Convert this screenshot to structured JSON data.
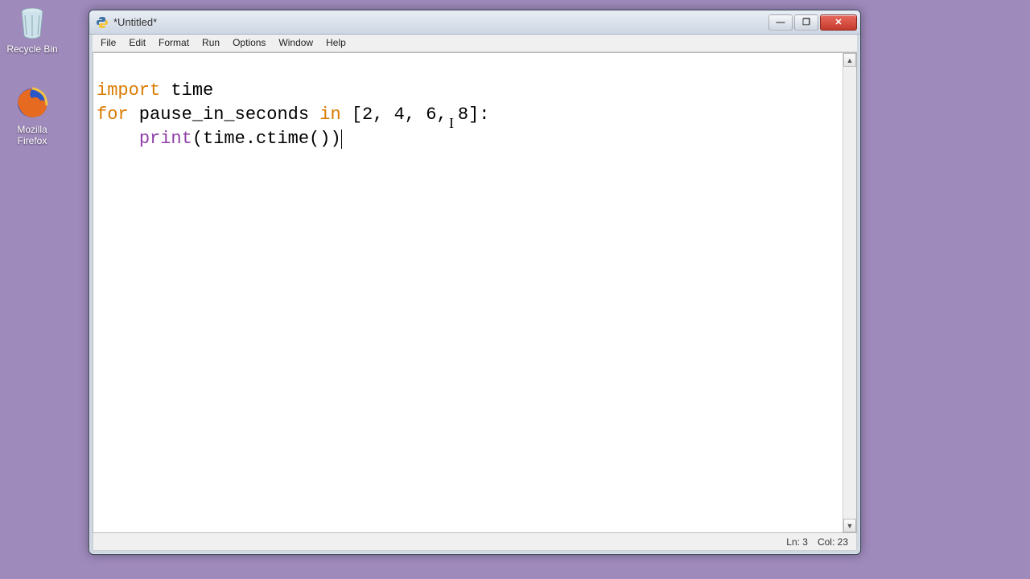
{
  "desktop": {
    "icons": [
      {
        "name": "recycle-bin",
        "label": "Recycle Bin"
      },
      {
        "name": "firefox",
        "label": "Mozilla\nFirefox"
      }
    ]
  },
  "window": {
    "title": "*Untitled*",
    "menubar": [
      "File",
      "Edit",
      "Format",
      "Run",
      "Options",
      "Window",
      "Help"
    ],
    "code": {
      "line1": {
        "kw": "import",
        "rest": " time"
      },
      "line2": {
        "kw1": "for",
        "mid": " pause_in_seconds ",
        "kw2": "in",
        "rest": " [2, 4, 6, 8]:"
      },
      "line3": {
        "indent": "    ",
        "fn": "print",
        "rest": "(time.ctime())"
      }
    },
    "status": {
      "line": "Ln: 3",
      "col": "Col: 23"
    },
    "buttons": {
      "min": "—",
      "max": "❐",
      "close": "✕"
    },
    "scroll": {
      "up": "▲",
      "down": "▼"
    }
  }
}
